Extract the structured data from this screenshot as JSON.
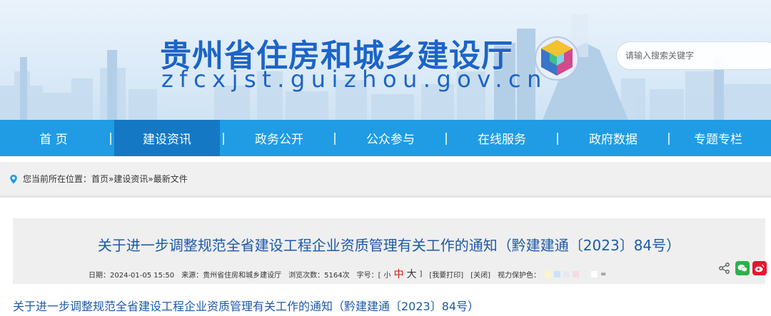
{
  "header": {
    "site_title": "贵州省住房和城乡建设厅",
    "site_domain": "zfcxjst.guizhou.gov.cn",
    "logo_icon": "cube-logo-icon",
    "search_placeholder": "请输入搜索关键字"
  },
  "nav": {
    "separator": "|",
    "items": [
      {
        "label": "首  页"
      },
      {
        "label": "建设资讯"
      },
      {
        "label": "政务公开"
      },
      {
        "label": "公众参与"
      },
      {
        "label": "在线服务"
      },
      {
        "label": "政府数据"
      },
      {
        "label": "专题专栏"
      }
    ],
    "active_index": 1
  },
  "breadcrumb": {
    "prefix": "您当前所在位置：",
    "items": [
      "首页",
      "建设资讯",
      "最新文件"
    ],
    "sep": " » "
  },
  "article": {
    "title": "关于进一步调整规范全省建设工程企业资质管理有关工作的通知（黔建建通〔2023〕84号）",
    "meta": {
      "date": "日期：2024-01-05 15:50",
      "source": "来源：贵州省住房和城乡建设厅",
      "views": "浏览次数：5164次",
      "font_prefix": "字号：[",
      "font_small": "小",
      "font_mid": "中",
      "font_big": "大",
      "font_suffix": "]",
      "print": "[我要打印]",
      "close": "[关闭]",
      "vision_label": "视力保护色：",
      "vision_reset": "="
    },
    "vision_colors": [
      "#fbf6c8",
      "#c8e4f6",
      "#e8e8f4",
      "#f6d8e6",
      "#eeeeee",
      "#ffffff"
    ],
    "body_first_line": "关于进一步调整规范全省建设工程企业资质管理有关工作的通知（黔建建通〔2023〕84号）"
  },
  "colors": {
    "nav_bg": "#1f9ce4",
    "nav_active": "#1578c4",
    "title_blue": "#1e5aa8"
  },
  "icons": {
    "share": "share-icon",
    "wechat": "wechat-icon",
    "weibo": "weibo-icon",
    "location": "location-pin-icon"
  }
}
